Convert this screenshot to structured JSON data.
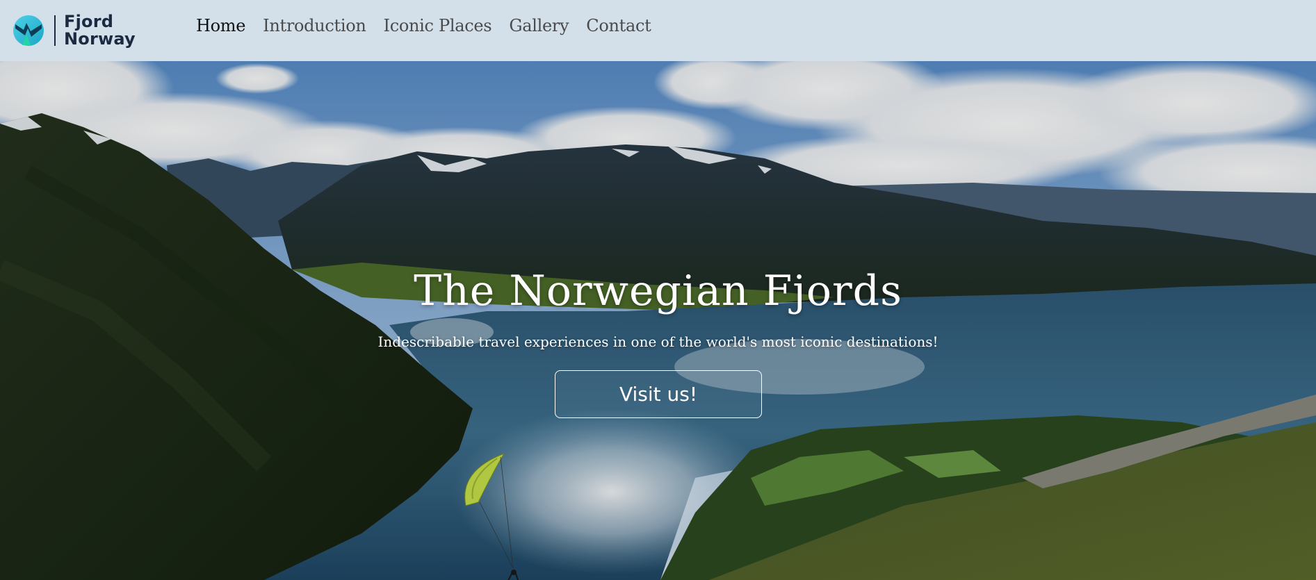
{
  "brand": {
    "line1": "Fjord",
    "line2": "Norway",
    "logo_icon": "fjord-logo-icon"
  },
  "nav": {
    "items": [
      {
        "label": "Home",
        "active": true
      },
      {
        "label": "Introduction",
        "active": false
      },
      {
        "label": "Iconic Places",
        "active": false
      },
      {
        "label": "Gallery",
        "active": false
      },
      {
        "label": "Contact",
        "active": false
      }
    ]
  },
  "hero": {
    "title": "The Norwegian Fjords",
    "subtitle": "Indescribable travel experiences in one of the world's most iconic destinations!",
    "button_label": "Visit us!",
    "background": "fjord-landscape-photo-with-paraglider"
  },
  "colors": {
    "navbar_bg": "#d3e0ea",
    "brand_text": "#1b2a40",
    "nav_active": "#111111",
    "nav_inactive": "#4a4a4a"
  }
}
